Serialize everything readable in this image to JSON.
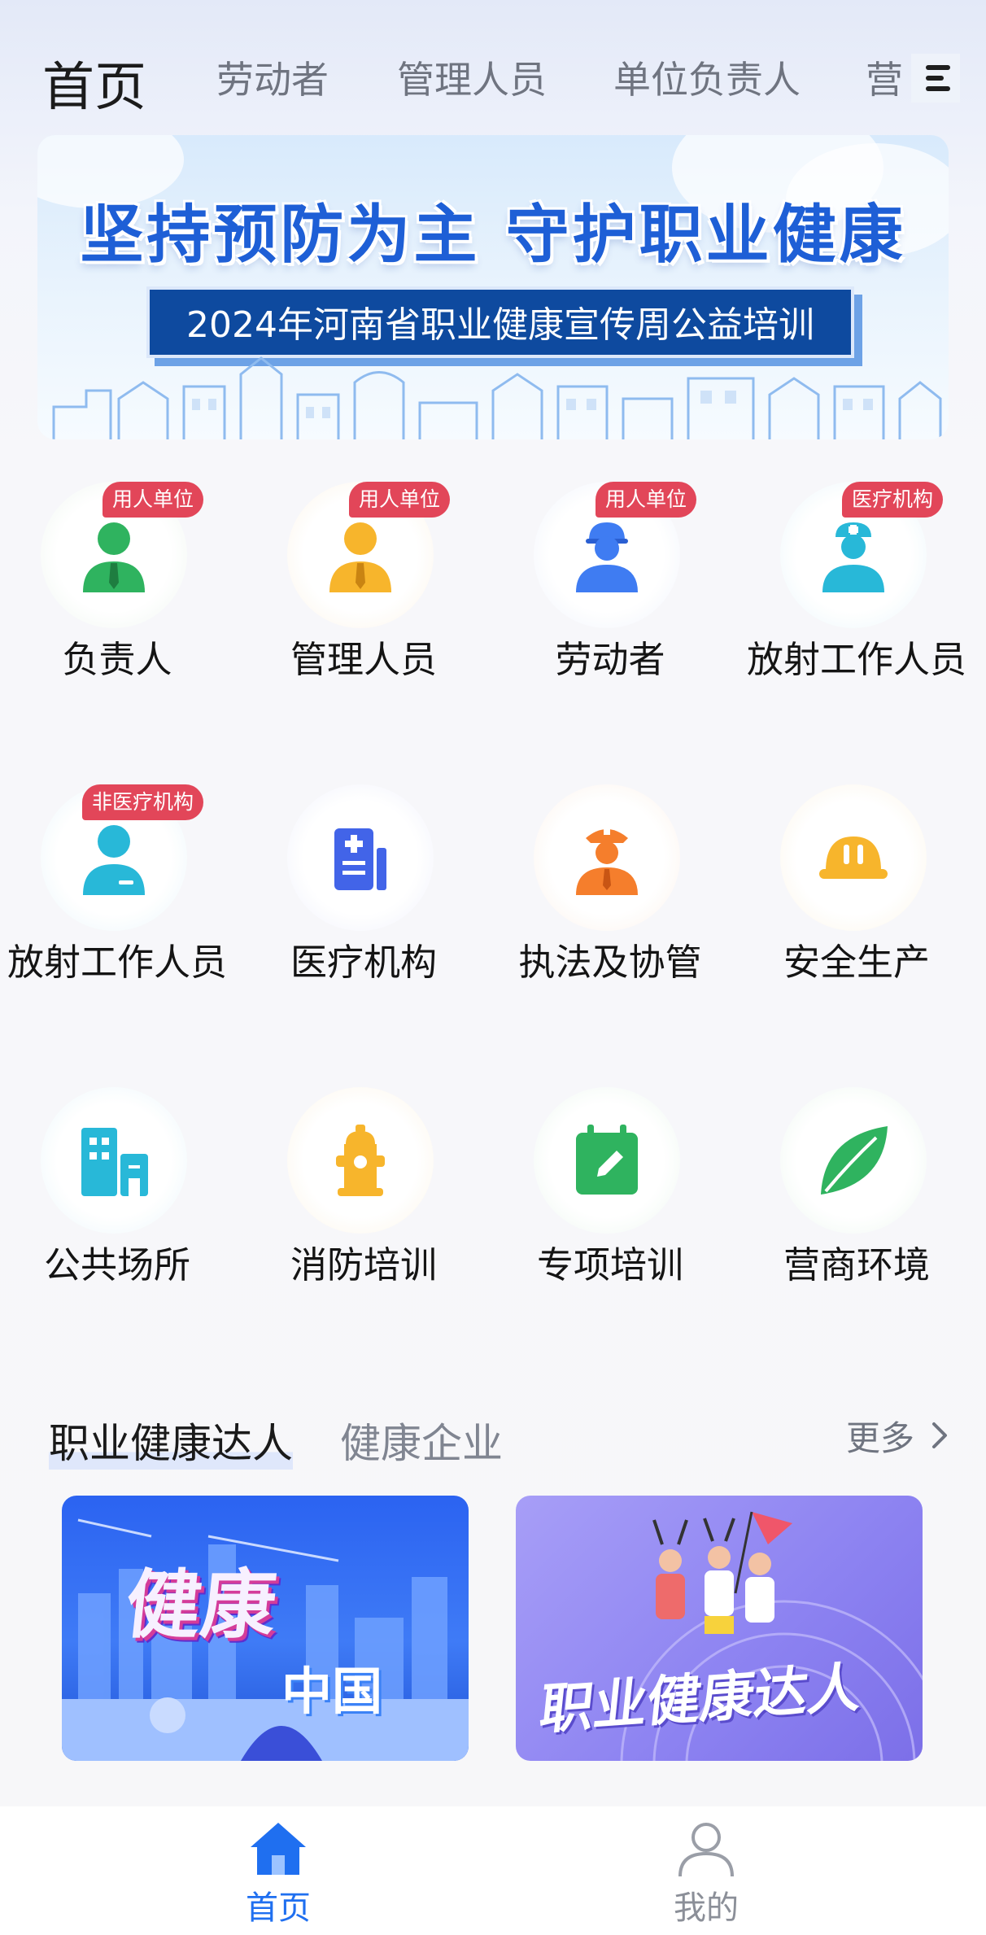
{
  "top_tabs": {
    "active": "首页",
    "items": [
      "劳动者",
      "管理人员",
      "单位负责人",
      "营"
    ]
  },
  "banner": {
    "title": "坚持预防为主  守护职业健康",
    "subtitle": "2024年河南省职业健康宣传周公益培训"
  },
  "grid": [
    {
      "label": "负责人",
      "badge": "用人单位",
      "icon": "person-tie-icon",
      "color": "#2fb35f"
    },
    {
      "label": "管理人员",
      "badge": "用人单位",
      "icon": "manager-icon",
      "color": "#f7b52c"
    },
    {
      "label": "劳动者",
      "badge": "用人单位",
      "icon": "worker-helmet-icon",
      "color": "#3f7cf2"
    },
    {
      "label": "放射工作人员",
      "badge": "医疗机构",
      "icon": "nurse-icon",
      "color": "#28b8d8"
    },
    {
      "label": "放射工作人员",
      "badge": "非医疗机构",
      "icon": "staff-icon",
      "color": "#28b8d8"
    },
    {
      "label": "医疗机构",
      "badge": "",
      "icon": "hospital-icon",
      "color": "#4264e8"
    },
    {
      "label": "执法及协管",
      "badge": "",
      "icon": "officer-icon",
      "color": "#f57e2c"
    },
    {
      "label": "安全生产",
      "badge": "",
      "icon": "hard-hat-icon",
      "color": "#f7b52c"
    },
    {
      "label": "公共场所",
      "badge": "",
      "icon": "building-icon",
      "color": "#28b8d8"
    },
    {
      "label": "消防培训",
      "badge": "",
      "icon": "fire-hydrant-icon",
      "color": "#f7b52c"
    },
    {
      "label": "专项培训",
      "badge": "",
      "icon": "calendar-edit-icon",
      "color": "#2fb35f"
    },
    {
      "label": "营商环境",
      "badge": "",
      "icon": "leaf-icon",
      "color": "#2fb35f"
    }
  ],
  "section": {
    "tab_active": "职业健康达人",
    "tab_inactive": "健康企业",
    "more": "更多"
  },
  "cards": [
    {
      "text_main": "健康",
      "text_sub": "中国"
    },
    {
      "text_main": "职业健康达人"
    }
  ],
  "bottom_nav": {
    "home": "首页",
    "me": "我的"
  },
  "colors": {
    "accent": "#1f6ff0",
    "badge": "#e24659",
    "banner_sub_bg": "#0e4a9f"
  }
}
